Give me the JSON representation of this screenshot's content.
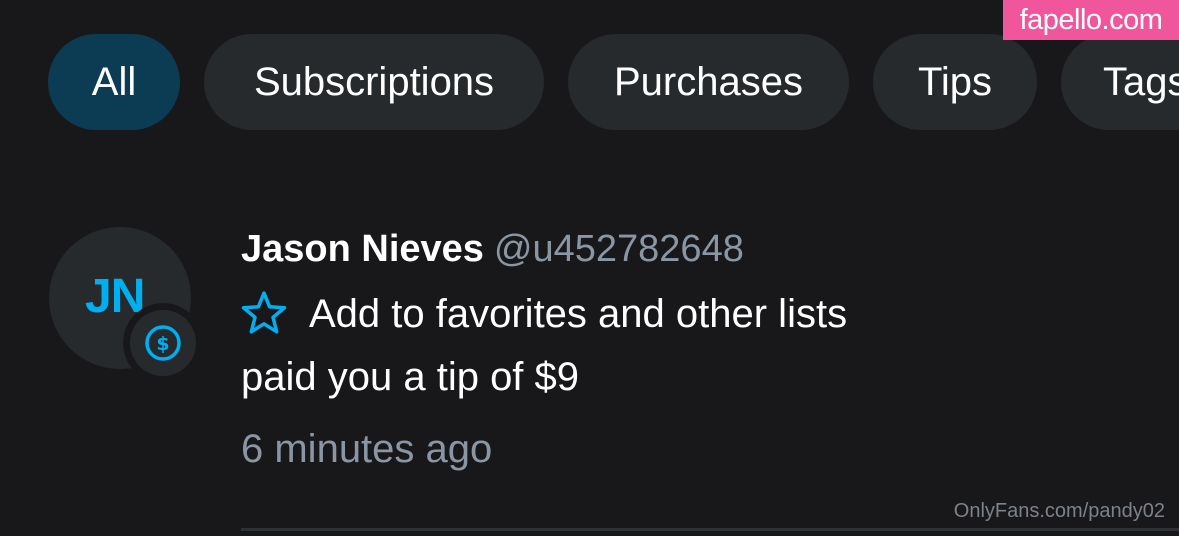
{
  "tabs": [
    {
      "label": "All",
      "active": true
    },
    {
      "label": "Subscriptions",
      "active": false
    },
    {
      "label": "Purchases",
      "active": false
    },
    {
      "label": "Tips",
      "active": false
    },
    {
      "label": "Tags",
      "active": false
    }
  ],
  "watermark": {
    "text": "fapello.com",
    "color": "#f0569c"
  },
  "notification": {
    "avatar_initials": "JN",
    "badge_icon": "dollar-circle-icon",
    "name": "Jason Nieves",
    "handle": "@u452782648",
    "favorites_icon": "star-outline-icon",
    "favorites_label": "Add to favorites and other lists",
    "message": "paid you a tip of $9",
    "time": "6 minutes ago"
  },
  "footer_watermark": "OnlyFans.com/pandy02",
  "colors": {
    "background": "#18181b",
    "accent": "#00aff0",
    "active_tab": "#0c3b54",
    "muted_text": "#8a96a3"
  }
}
